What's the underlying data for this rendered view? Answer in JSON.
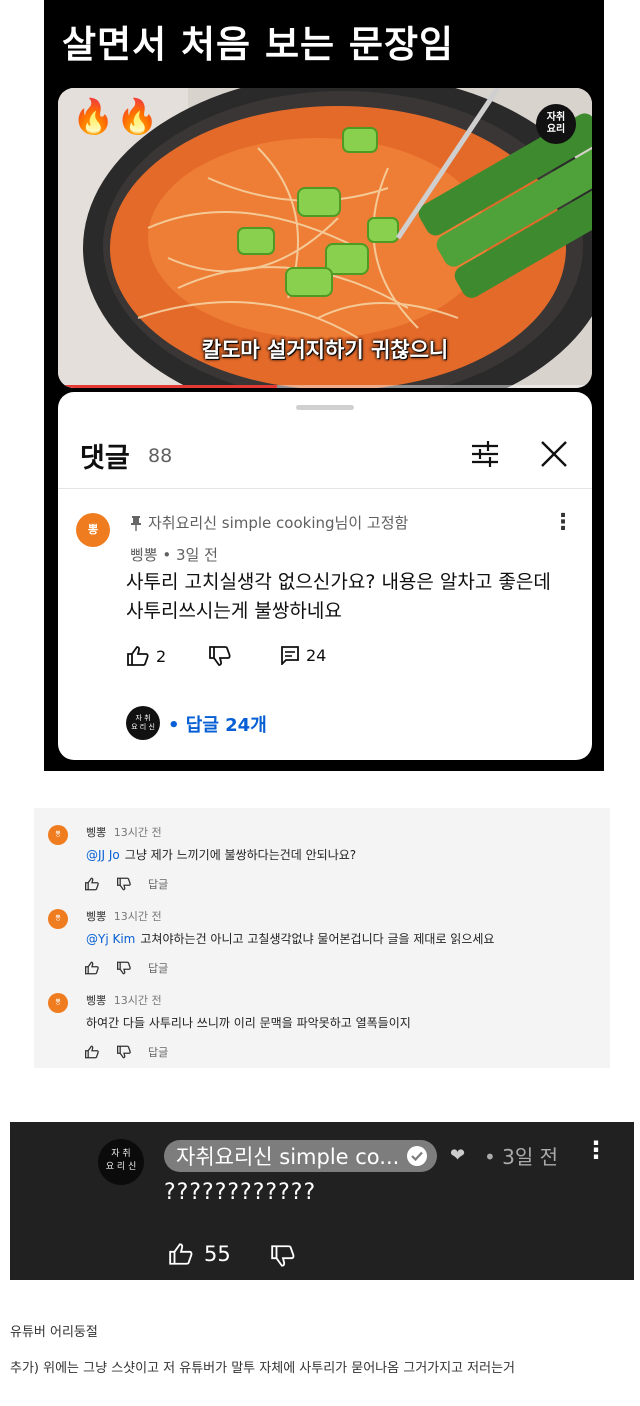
{
  "panel1": {
    "caption": "살면서 처음 보는 문장임",
    "video": {
      "fire_emojis": [
        "🔥",
        "🔥"
      ],
      "brand_badge": "자취\n요리",
      "subtitle": "칼도마 설거지하기 귀찮으니",
      "progress_fraction": 0.41
    },
    "comments": {
      "title": "댓글",
      "count": "88",
      "filter_icon": "filter-icon",
      "close_icon": "close-icon",
      "pinned_label": "자취요리신 simple cooking님이 고정함",
      "avatar_text": "뽕",
      "meta": "삥뽕 • 3일 전",
      "text": "사투리 고치실생각 없으신가요? 내용은 알차고 좋은데\n사투리쓰시는게 불쌍하네요",
      "likes": "2",
      "replies_count": "24",
      "reply_avatar_text": "자 취\n요 리 신",
      "reply_link": "• 답글 24개"
    }
  },
  "panel2": {
    "replies": [
      {
        "author": "삥뽕",
        "time": "13시간 전",
        "mention": "@JJ Jo",
        "text": "그냥 제가 느끼기에 불쌍하다는건데 안되나요?",
        "reply_label": "답글",
        "avatar_text": "뽕"
      },
      {
        "author": "삥뽕",
        "time": "13시간 전",
        "mention": "@Yj Kim",
        "text": "고쳐야하는건 아니고 고칠생각없냐 물어본겁니다 글을 제대로 읽으세요",
        "reply_label": "답글",
        "avatar_text": "뽕"
      },
      {
        "author": "삥뽕",
        "time": "13시간 전",
        "mention": "",
        "text": "하여간 다들 사투리나 쓰니까 이리 문맥을 파악못하고 열폭들이지",
        "reply_label": "답글",
        "avatar_text": "뽕"
      }
    ]
  },
  "panel3": {
    "avatar_text": "자 취\n요 리 신",
    "channel_name": "자취요리신 simple co...",
    "time": "• 3일 전",
    "text": "????????????",
    "likes": "55"
  },
  "footer": {
    "note1": "유튜버 어리둥절",
    "note2": "추가) 위에는 그냥 스샷이고 저 유튜버가 말투 자체에 사투리가 묻어나옴 그거가지고 저러는거"
  },
  "colors": {
    "accent_red": "#e53935",
    "link_blue": "#065fd4",
    "avatar_orange": "#ef7d1f",
    "dark_panel": "#212121"
  }
}
